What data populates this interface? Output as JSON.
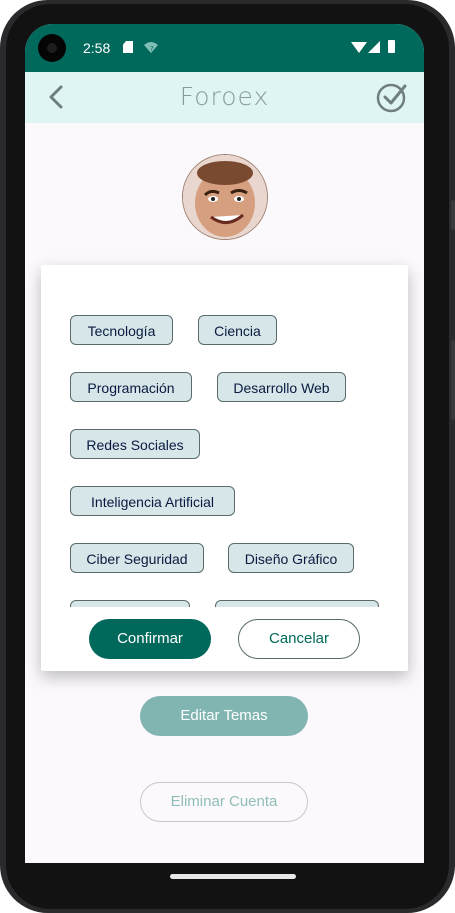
{
  "status_bar": {
    "time": "2:58",
    "sd_icon": "sd-card-icon",
    "wifi_question_icon": "wifi-question-icon",
    "wifi_icon": "wifi-icon",
    "signal_icon": "signal-icon",
    "battery_icon": "battery-icon",
    "bg_color": "#00695c"
  },
  "app_bar": {
    "title": "Foroex",
    "back_icon": "back-arrow-icon",
    "confirm_icon": "check-circle-icon",
    "bg_color": "#dff5f3"
  },
  "profile": {
    "avatar_icon": "avatar"
  },
  "dialog": {
    "topics": [
      "Tecnología",
      "Ciencia",
      "Programación",
      "Desarrollo Web",
      "Redes Sociales",
      "Inteligencia Artificial",
      "Ciber Seguridad",
      "Diseño Gráfico"
    ],
    "confirm_label": "Confirmar",
    "cancel_label": "Cancelar"
  },
  "actions": {
    "edit_topics_label": "Editar Temas",
    "delete_account_label": "Eliminar Cuenta"
  },
  "colors": {
    "primary": "#00695c",
    "chip_bg": "#d7e6e8",
    "chip_text": "#0a1a40"
  }
}
